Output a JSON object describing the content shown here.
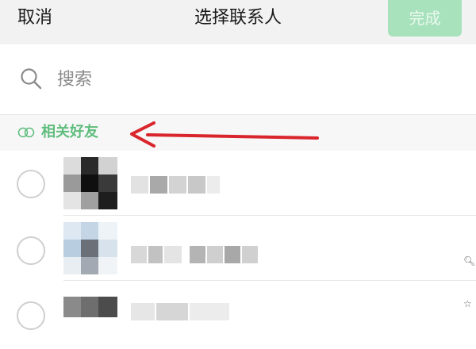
{
  "header": {
    "cancel_label": "取消",
    "title": "选择联系人",
    "done_label": "完成"
  },
  "search": {
    "placeholder": "搜索",
    "value": ""
  },
  "section": {
    "label": "相关好友"
  },
  "contacts": [
    {
      "selected": false
    },
    {
      "selected": false
    },
    {
      "selected": false
    }
  ],
  "colors": {
    "accent_green": "#5fbd7d",
    "done_disabled_bg": "#a8e2bd",
    "arrow_red": "#d9262c",
    "header_bg": "#f2f2f2"
  },
  "icons": {
    "search": "search-icon",
    "friends": "related-friends-icon",
    "arrow": "red-arrow-annotation",
    "side_search": "search-icon",
    "side_star": "star-icon"
  }
}
